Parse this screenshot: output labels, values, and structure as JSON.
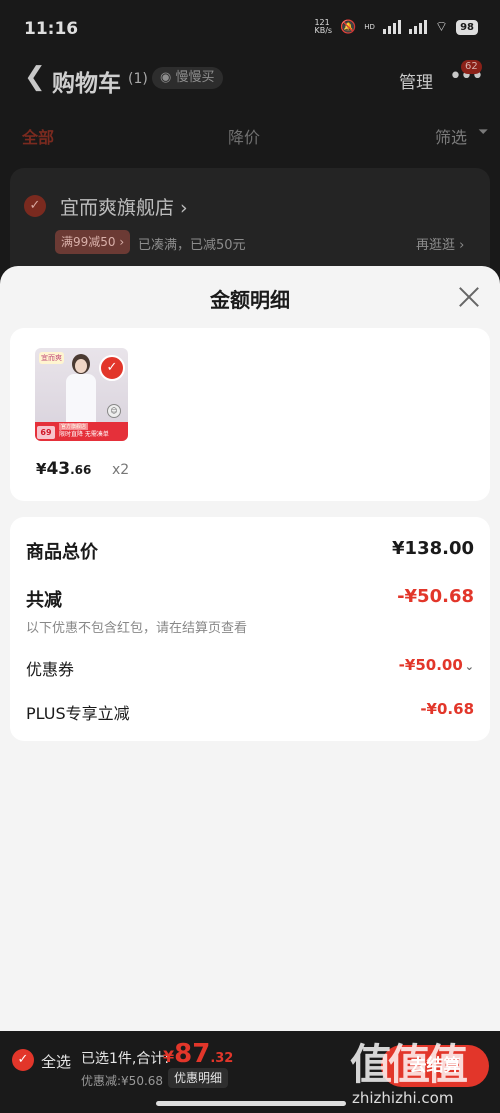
{
  "status_bar": {
    "time": "11:16",
    "net_speed": "121\nKB/s",
    "hd": "HD",
    "battery": "98"
  },
  "nav": {
    "back_icon": "chevron-left-icon",
    "title": "购物车",
    "count": "(1)",
    "slow_buy": "慢慢买",
    "manage": "管理",
    "more_badge": "62"
  },
  "tabs": {
    "all": "全部",
    "price_drop": "降价",
    "filter": "筛选"
  },
  "store": {
    "name": "宜而爽旗舰店",
    "promo_tag": "满99减50",
    "promo_text": "已凑满，已减50元",
    "shop_more": "再逛逛"
  },
  "sheet": {
    "title": "金额明细",
    "product": {
      "thumb_tag": "宜而爽",
      "thumb_price": "69",
      "thumb_promo_top": "官方旗舰店",
      "thumb_promo": "限时直降 无需凑单",
      "currency": "¥",
      "price_int": "43",
      "price_dec": ".66",
      "quantity": "x2"
    },
    "rows": {
      "total_label": "商品总价",
      "total_value": "¥138.00",
      "reduce_label": "共减",
      "reduce_value": "-¥50.68",
      "note": "以下优惠不包含红包，请在结算页查看",
      "coupon_label": "优惠券",
      "coupon_value": "-¥50.00",
      "plus_label": "PLUS专享立减",
      "plus_value": "-¥0.68"
    }
  },
  "bottom_bar": {
    "select_all": "全选",
    "selected_text": "已选1件,合计:",
    "currency": "¥",
    "total_int": "87",
    "total_dec": ".32",
    "discount_text": "优惠减:¥50.68",
    "detail_button": "优惠明细",
    "checkout": "去结算",
    "watermark": "值值值",
    "watermark_url": "zhizhizhi.com"
  },
  "colors": {
    "accent_red": "#e2362a",
    "sheet_bg": "#f4f4f4",
    "overlay_bg": "#191919"
  }
}
